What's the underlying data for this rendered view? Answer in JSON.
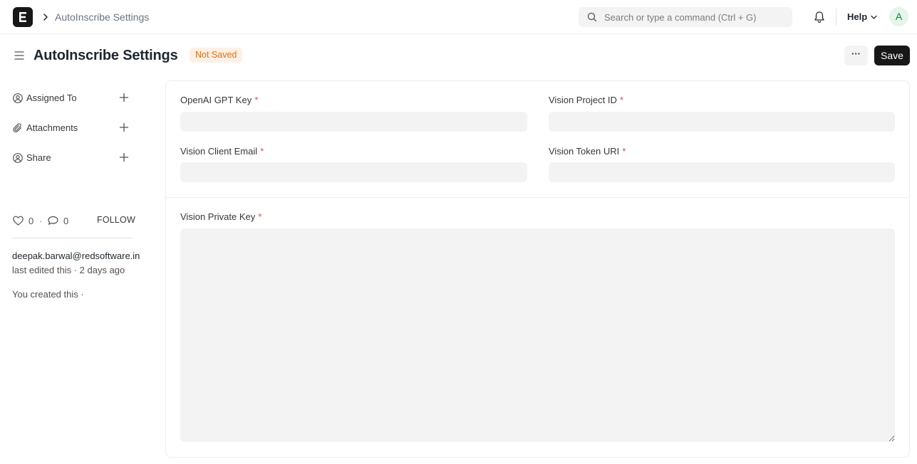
{
  "navbar": {
    "app_logo": "app-logo",
    "breadcrumb": "AutoInscribe Settings",
    "search_placeholder": "Search or type a command (Ctrl + G)",
    "help_label": "Help",
    "avatar_initial": "A"
  },
  "header": {
    "title": "AutoInscribe Settings",
    "status": "Not Saved",
    "more_label": "···",
    "save_label": "Save"
  },
  "sidebar": {
    "items": [
      {
        "label": "Assigned To",
        "icon": "assign-icon"
      },
      {
        "label": "Attachments",
        "icon": "paperclip-icon"
      },
      {
        "label": "Share",
        "icon": "share-icon"
      }
    ],
    "likes": "0",
    "comments": "0",
    "separator": "·",
    "follow_label": "FOLLOW",
    "editor": "deepak.barwal@redsoftware.in",
    "edited_text": "last edited this · 2 days ago",
    "created_text": "You created this ·"
  },
  "form": {
    "fields": [
      {
        "label": "OpenAI GPT Key",
        "required": "*",
        "value": ""
      },
      {
        "label": "Vision Project ID",
        "required": "*",
        "value": ""
      },
      {
        "label": "Vision Client Email",
        "required": "*",
        "value": ""
      },
      {
        "label": "Vision Token URI",
        "required": "*",
        "value": ""
      }
    ],
    "private_key": {
      "label": "Vision Private Key",
      "required": "*",
      "value": ""
    }
  },
  "colors": {
    "accent": "#171717",
    "badge_bg": "#fff0e6",
    "badge_text": "#e0700f",
    "required": "#e24c4c"
  }
}
